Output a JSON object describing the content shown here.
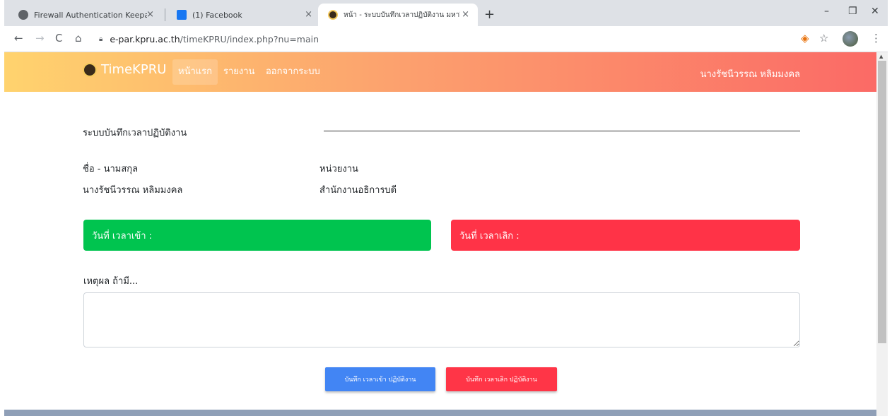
{
  "browser": {
    "tabs": [
      {
        "title": "Firewall Authentication Keepalive",
        "favicon": "globe-icon",
        "close": "×"
      },
      {
        "title": "(1) Facebook",
        "favicon": "facebook-icon",
        "close": "×"
      },
      {
        "title": "หน้า - ระบบบันทึกเวลาปฏิบัติงาน มหาวิ",
        "favicon": "kpru-logo-icon",
        "close": "×",
        "active": true
      }
    ],
    "new_tab": "+",
    "window_controls": {
      "minimize": "–",
      "restore": "❐",
      "close": "✕"
    },
    "nav": {
      "back": "←",
      "forward": "→",
      "reload": "C",
      "home": "⌂"
    },
    "url_host": "e-par.kpru.ac.th",
    "url_path": "/timeKPRU/index.php?nu=main",
    "toolbar_icons": {
      "extension": "◈",
      "star": "☆",
      "menu": "⋮"
    }
  },
  "navbar": {
    "brand": "TimeKPRU",
    "links": [
      "หน้าแรก",
      "รายงาน",
      "ออกจากระบบ"
    ],
    "user": "นางรัชนีวรรณ หลิมมงคล",
    "gradient": [
      "#ffd36e",
      "#fca16e",
      "#fb6a66"
    ]
  },
  "main": {
    "system_title": "ระบบบันทึกเวลาปฏิบัติงาน",
    "name_label": "ชื่อ - นามสกุล",
    "name_value": "นางรัชนีวรรณ หลิมมงคล",
    "unit_label": "หน่วยงาน",
    "unit_value": "สำนักงานอธิการบดี",
    "checkin_card": "วันที่ เวลาเข้า :",
    "checkout_card": "วันที่ เวลาเลิก :",
    "reason_label": "เหตุผล ถ้ามี...",
    "reason_value": "",
    "save_checkin_button": "บันทึก เวลาเข้า ปฏิบัติงาน",
    "save_checkout_button": "บันทึก เวลาเลิก ปฏิบัติงาน"
  },
  "colors": {
    "checkin_green": "#00c44f",
    "checkout_red": "#ff3347",
    "button_blue": "#4285f4",
    "button_red": "#ff3547"
  }
}
